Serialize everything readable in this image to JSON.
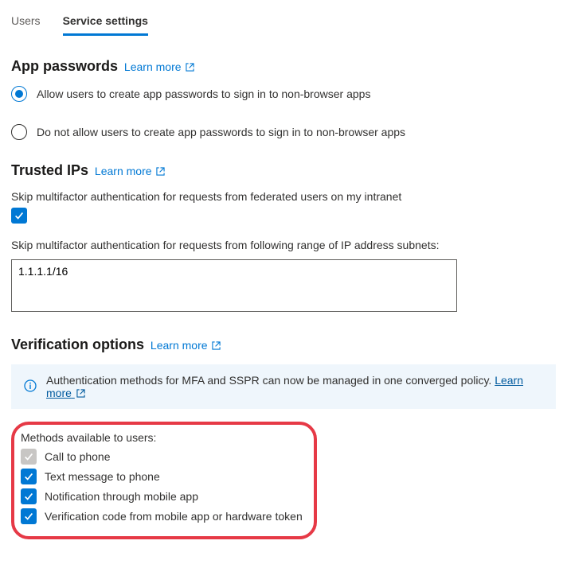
{
  "tabs": {
    "users": "Users",
    "service": "Service settings"
  },
  "appPasswords": {
    "title": "App passwords",
    "learn": "Learn more",
    "opt1": "Allow users to create app passwords to sign in to non-browser apps",
    "opt2": "Do not allow users to create app passwords to sign in to non-browser apps"
  },
  "trustedIps": {
    "title": "Trusted IPs",
    "learn": "Learn more",
    "skipFederated": "Skip multifactor authentication for requests from federated users on my intranet",
    "skipRangeLabel": "Skip multifactor authentication for requests from following range of IP address subnets:",
    "ipValue": "1.1.1.1/16"
  },
  "verification": {
    "title": "Verification options",
    "learn": "Learn more",
    "bannerText": "Authentication methods for MFA and SSPR can now be managed in one converged policy.",
    "bannerLink": "Learn more",
    "methodsLabel": "Methods available to users:",
    "method1": "Call to phone",
    "method2": "Text message to phone",
    "method3": "Notification through mobile app",
    "method4": "Verification code from mobile app or hardware token"
  }
}
